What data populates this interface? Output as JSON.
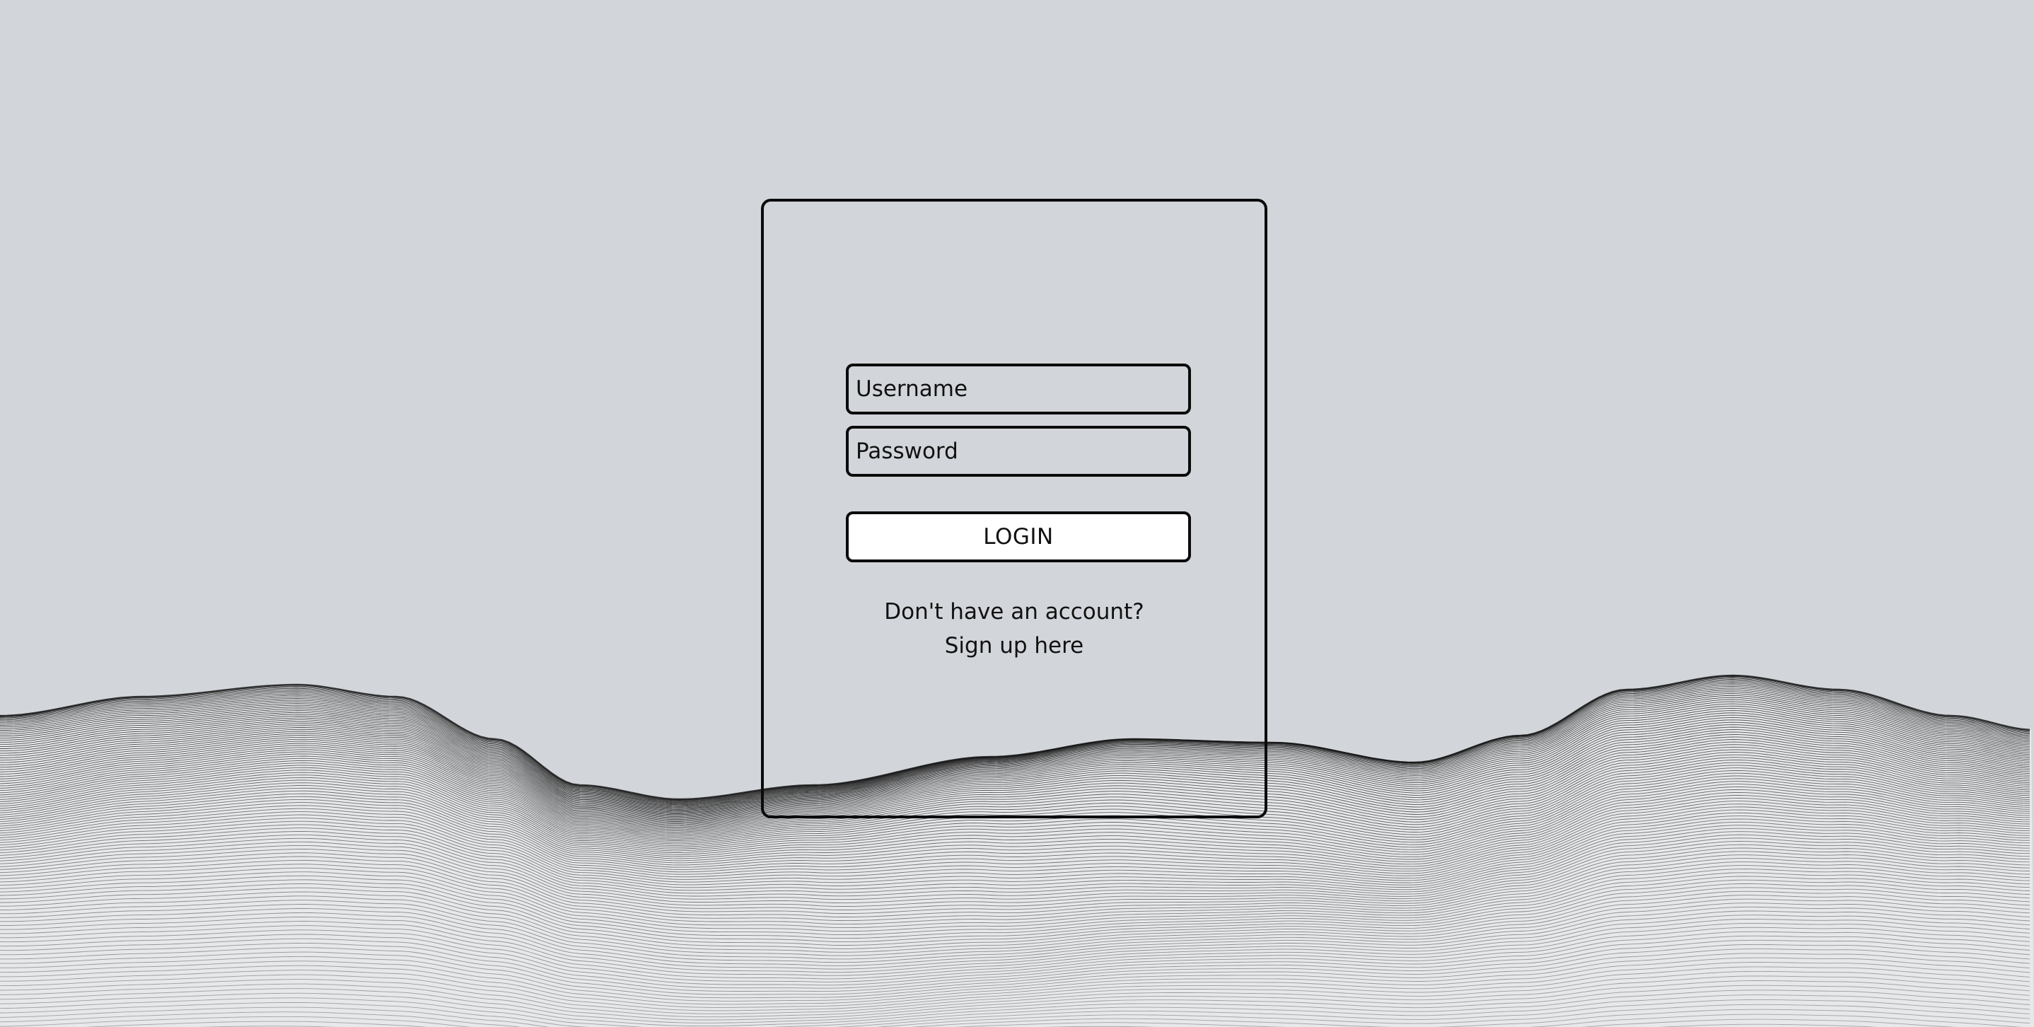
{
  "login": {
    "username_placeholder": "Username",
    "password_placeholder": "Password",
    "login_button_label": "LOGIN",
    "signup_prompt": "Don't have an account?",
    "signup_link": "Sign up here"
  },
  "colors": {
    "background": "#d2d5da",
    "border": "#0b0b0b",
    "button_background": "#ffffff",
    "terrain_fill": "#e6e8ea",
    "terrain_line": "#1a1a1a"
  }
}
